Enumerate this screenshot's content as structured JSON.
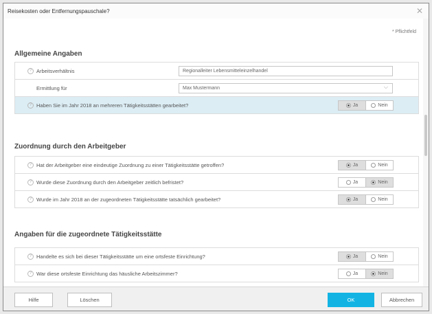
{
  "dialog": {
    "title": "Reisekosten oder Entfernungspauschale?",
    "close_glyph": "✕",
    "required_note": "* Pflichtfeld"
  },
  "sections": {
    "general": {
      "title": "Allgemeine Angaben",
      "employment_label": "Arbeitsverhältnis",
      "employment_value": "Regionalleiter Lebensmitteleinzelhandel",
      "calc_label": "Ermittlung für",
      "calc_value": "Max Mustermann",
      "multi_sites_question": "Haben Sie im Jahr 2018 an mehreren Tätigkeitsstätten gearbeitet?",
      "multi_sites_answer": "Ja"
    },
    "assignment": {
      "title": "Zuordnung durch den Arbeitgeber",
      "q1": "Hat der Arbeitgeber eine eindeutige Zuordnung zu einer Tätigkeitsstätte getroffen?",
      "q1_answer": "Ja",
      "q2": "Wurde diese Zuordnung durch den Arbeitgeber zeitlich befristet?",
      "q2_answer": "Nein",
      "q3": "Wurde im Jahr 2018 an der zugeordneten Tätigkeitsstätte tatsächlich gearbeitet?",
      "q3_answer": "Ja"
    },
    "site": {
      "title": "Angaben für die zugeordnete Tätigkeitsstätte",
      "q1": "Handelte es sich bei dieser Tätigkeitsstätte um eine ortsfeste Einrichtung?",
      "q1_answer": "Ja",
      "q2": "War diese ortsfeste Einrichtung das häusliche Arbeitszimmer?",
      "q2_answer": "Nein"
    }
  },
  "options": {
    "yes": "Ja",
    "no": "Nein"
  },
  "footer": {
    "help": "Hilfe",
    "delete": "Löschen",
    "ok": "OK",
    "cancel": "Abbrechen"
  },
  "colors": {
    "primary": "#13b4e4",
    "highlight_row": "#dcedf4"
  }
}
